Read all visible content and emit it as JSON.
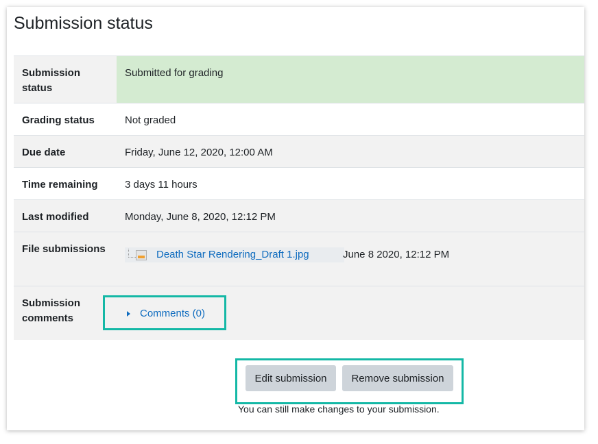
{
  "page": {
    "title": "Submission status"
  },
  "rows": {
    "submission_status": {
      "label": "Submission status",
      "value": "Submitted for grading"
    },
    "grading_status": {
      "label": "Grading status",
      "value": "Not graded"
    },
    "due_date": {
      "label": "Due date",
      "value": "Friday, June 12, 2020, 12:00 AM"
    },
    "time_remaining": {
      "label": "Time remaining",
      "value": "3 days 11 hours"
    },
    "last_modified": {
      "label": "Last modified",
      "value": "Monday, June 8, 2020, 12:12 PM"
    },
    "file_submissions": {
      "label": "File submissions",
      "file_name": "Death Star Rendering_Draft 1.jpg",
      "file_date": "June 8 2020, 12:12 PM",
      "file_icon": "image-file-icon"
    },
    "submission_comments": {
      "label": "Submission comments",
      "toggle": "Comments (0)"
    }
  },
  "actions": {
    "edit_label": "Edit submission",
    "remove_label": "Remove submission",
    "hint": "You can still make changes to your submission."
  },
  "colors": {
    "submitted_bg": "#d4ebd1",
    "link": "#0f6cbf",
    "highlight": "#14b8a6",
    "button_bg": "#ced4da"
  }
}
